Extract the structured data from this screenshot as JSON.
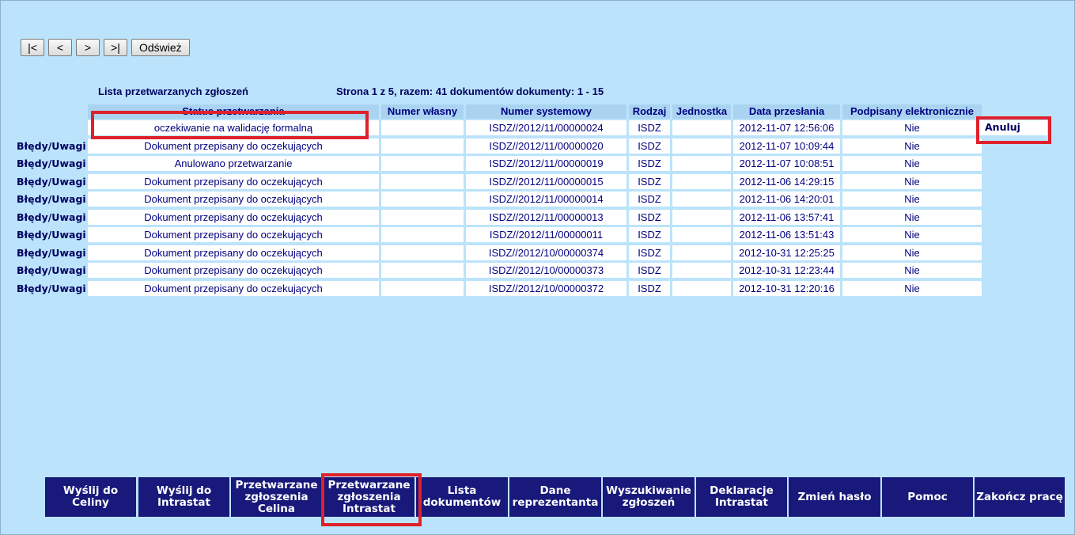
{
  "pager": {
    "first": "|<",
    "prev": "<",
    "next": ">",
    "last": ">|",
    "refresh": "Odśwież"
  },
  "list_title": "Lista przetwarzanych zgłoszeń",
  "page_info": "Strona 1 z 5, razem: 41 dokumentów dokumenty: 1 - 15",
  "columns": [
    "Status przetwarzania",
    "Numer własny",
    "Numer systemowy",
    "Rodzaj",
    "Jednostka",
    "Data przesłania",
    "Podpisany elektronicznie"
  ],
  "rows": [
    {
      "errors": "",
      "status": "oczekiwanie na walidację formalną",
      "own_no": "",
      "sys_no": "ISDZ//2012/11/00000024",
      "type": "ISDZ",
      "unit": "",
      "date": "2012-11-07 12:56:06",
      "signed": "Nie",
      "action": "Anuluj"
    },
    {
      "errors": "Błędy/Uwagi",
      "status": "Dokument przepisany do oczekujących",
      "own_no": "",
      "sys_no": "ISDZ//2012/11/00000020",
      "type": "ISDZ",
      "unit": "",
      "date": "2012-11-07 10:09:44",
      "signed": "Nie",
      "action": ""
    },
    {
      "errors": "Błędy/Uwagi",
      "status": "Anulowano przetwarzanie",
      "own_no": "",
      "sys_no": "ISDZ//2012/11/00000019",
      "type": "ISDZ",
      "unit": "",
      "date": "2012-11-07 10:08:51",
      "signed": "Nie",
      "action": ""
    },
    {
      "errors": "Błędy/Uwagi",
      "status": "Dokument przepisany do oczekujących",
      "own_no": "",
      "sys_no": "ISDZ//2012/11/00000015",
      "type": "ISDZ",
      "unit": "",
      "date": "2012-11-06 14:29:15",
      "signed": "Nie",
      "action": ""
    },
    {
      "errors": "Błędy/Uwagi",
      "status": "Dokument przepisany do oczekujących",
      "own_no": "",
      "sys_no": "ISDZ//2012/11/00000014",
      "type": "ISDZ",
      "unit": "",
      "date": "2012-11-06 14:20:01",
      "signed": "Nie",
      "action": ""
    },
    {
      "errors": "Błędy/Uwagi",
      "status": "Dokument przepisany do oczekujących",
      "own_no": "",
      "sys_no": "ISDZ//2012/11/00000013",
      "type": "ISDZ",
      "unit": "",
      "date": "2012-11-06 13:57:41",
      "signed": "Nie",
      "action": ""
    },
    {
      "errors": "Błędy/Uwagi",
      "status": "Dokument przepisany do oczekujących",
      "own_no": "",
      "sys_no": "ISDZ//2012/11/00000011",
      "type": "ISDZ",
      "unit": "",
      "date": "2012-11-06 13:51:43",
      "signed": "Nie",
      "action": ""
    },
    {
      "errors": "Błędy/Uwagi",
      "status": "Dokument przepisany do oczekujących",
      "own_no": "",
      "sys_no": "ISDZ//2012/10/00000374",
      "type": "ISDZ",
      "unit": "",
      "date": "2012-10-31 12:25:25",
      "signed": "Nie",
      "action": ""
    },
    {
      "errors": "Błędy/Uwagi",
      "status": "Dokument przepisany do oczekujących",
      "own_no": "",
      "sys_no": "ISDZ//2012/10/00000373",
      "type": "ISDZ",
      "unit": "",
      "date": "2012-10-31 12:23:44",
      "signed": "Nie",
      "action": ""
    },
    {
      "errors": "Błędy/Uwagi",
      "status": "Dokument przepisany do oczekujących",
      "own_no": "",
      "sys_no": "ISDZ//2012/10/00000372",
      "type": "ISDZ",
      "unit": "",
      "date": "2012-10-31 12:20:16",
      "signed": "Nie",
      "action": ""
    }
  ],
  "menu": [
    "Wyślij do\nCeliny",
    "Wyślij do\nIntrastat",
    "Przetwarzane\nzgłoszenia\nCelina",
    "Przetwarzane\nzgłoszenia\nIntrastat",
    "Lista\ndokumentów",
    "Dane\nreprezentanta",
    "Wyszukiwanie\nzgłoszeń",
    "Deklaracje\nIntrastat",
    "Zmień hasło",
    "Pomoc",
    "Zakończ pracę"
  ],
  "colors": {
    "background": "#bbe3fb",
    "header_bg": "#a9d3f0",
    "menu_bg": "#18197a",
    "highlight": "#e0202a"
  }
}
